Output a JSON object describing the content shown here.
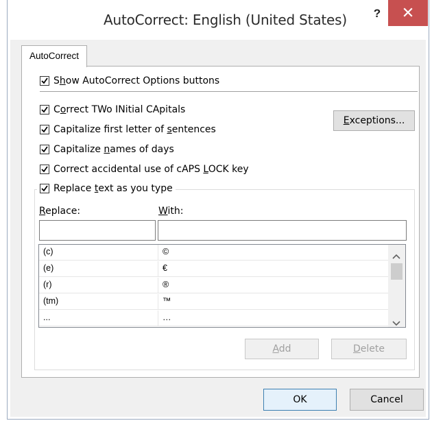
{
  "window": {
    "title": "AutoCorrect: English (United States)",
    "help_label": "?",
    "close_icon": "close-icon"
  },
  "tab": {
    "label": "AutoCorrect"
  },
  "options": {
    "show_buttons": {
      "pre": "S",
      "ul": "h",
      "post": "ow AutoCorrect Options buttons",
      "checked": true
    },
    "correct_two_initial": {
      "pre": "C",
      "ul": "o",
      "post": "rrect TWo INitial CApitals",
      "checked": true
    },
    "capitalize_first": {
      "pre": "Capitalize first letter of ",
      "ul": "s",
      "post": "entences",
      "checked": true
    },
    "capitalize_days": {
      "pre": "Capitalize ",
      "ul": "n",
      "post": "ames of days",
      "checked": true
    },
    "caps_lock": {
      "pre": "Correct accidental use of cAPS ",
      "ul": "L",
      "post": "OCK key",
      "checked": true
    },
    "replace_text": {
      "pre": "Replace ",
      "ul": "t",
      "post": "ext as you type",
      "checked": true
    }
  },
  "buttons": {
    "exceptions": {
      "pre": "",
      "ul": "E",
      "post": "xceptions..."
    },
    "add": {
      "pre": "",
      "ul": "A",
      "post": "dd"
    },
    "delete": {
      "pre": "",
      "ul": "D",
      "post": "elete"
    },
    "ok": "OK",
    "cancel": "Cancel"
  },
  "replace_section": {
    "replace_label": {
      "pre": "",
      "ul": "R",
      "post": "eplace:"
    },
    "with_label": {
      "pre": "",
      "ul": "W",
      "post": "ith:"
    },
    "replace_value": "",
    "with_value": ""
  },
  "entries": [
    {
      "replace": "(c)",
      "with": "©"
    },
    {
      "replace": "(e)",
      "with": "€"
    },
    {
      "replace": "(r)",
      "with": "®"
    },
    {
      "replace": "(tm)",
      "with": "™"
    },
    {
      "replace": "...",
      "with": "…"
    }
  ],
  "colors": {
    "close_button": "#c75050",
    "dialog_bg": "#f0f0f0",
    "disabled_text": "#a0a0a0"
  }
}
